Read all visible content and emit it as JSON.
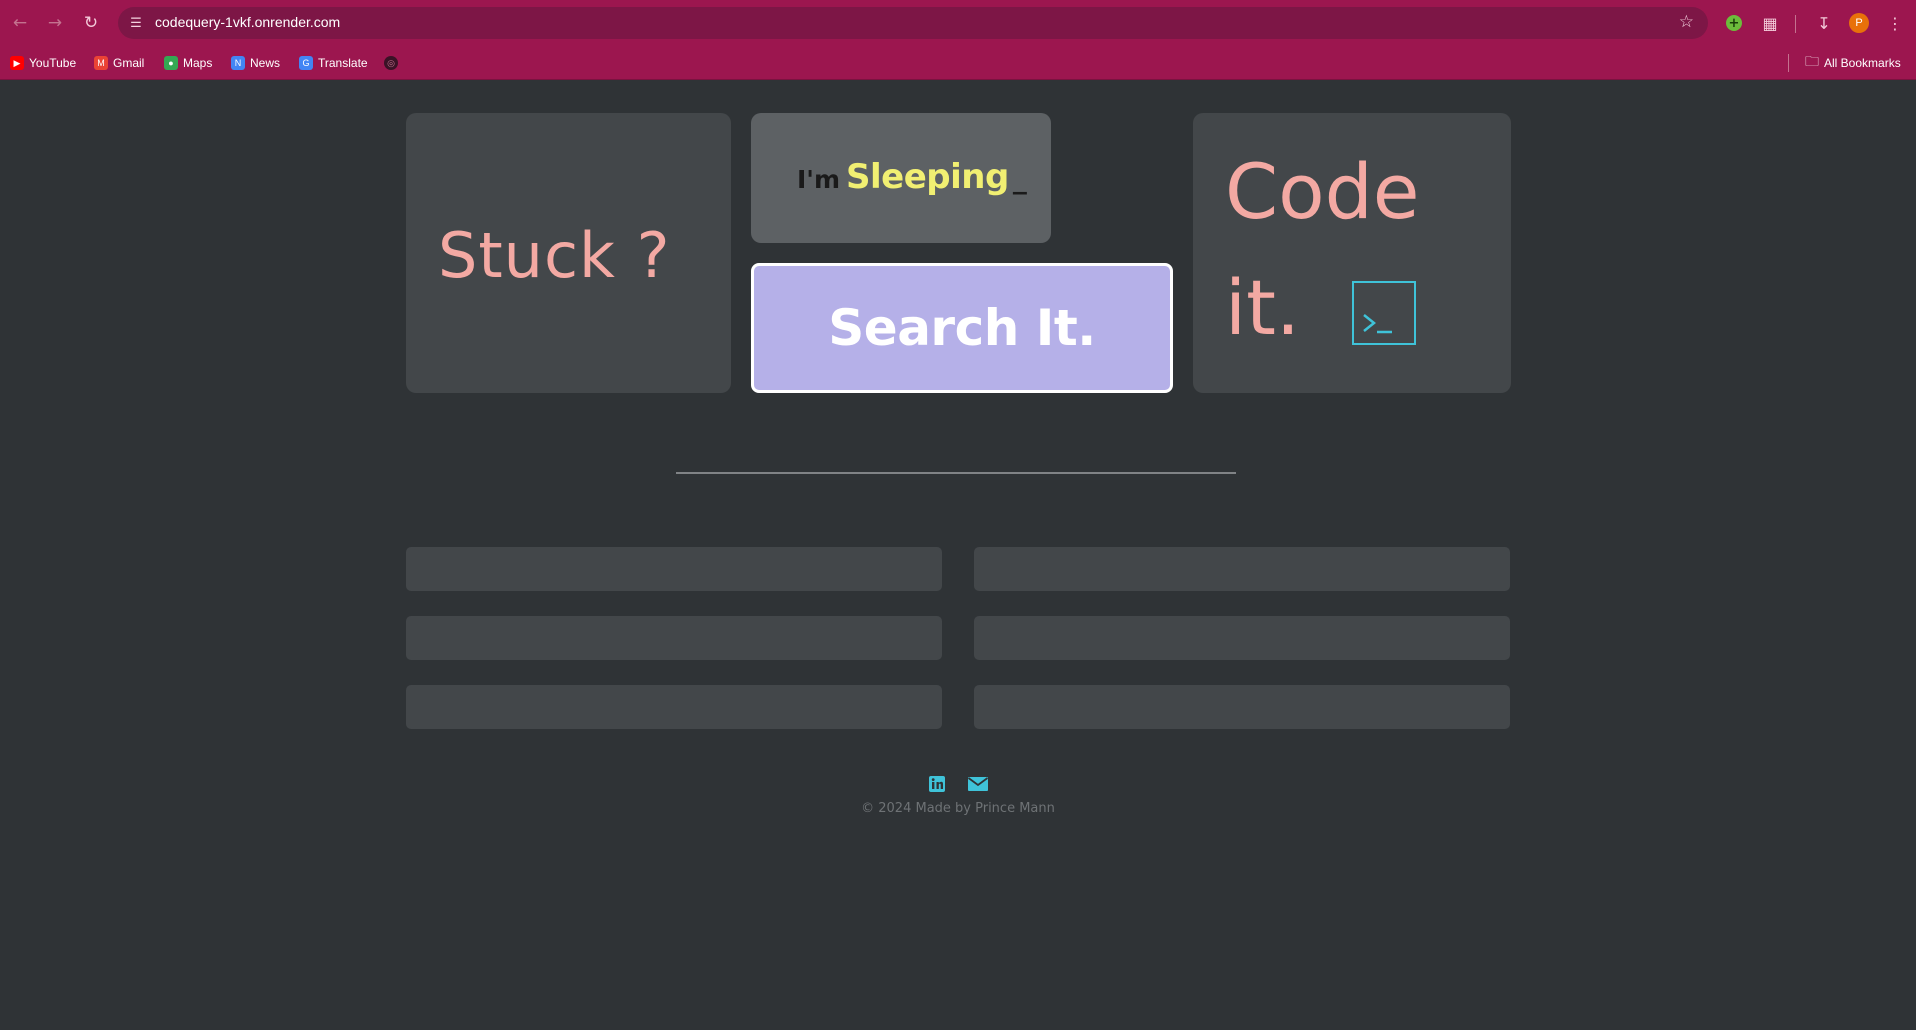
{
  "browser": {
    "url": "codequery-1vkf.onrender.com",
    "bookmarks": [
      {
        "label": "YouTube",
        "color": "#ff0000"
      },
      {
        "label": "Gmail",
        "color": "#ea4335"
      },
      {
        "label": "Maps",
        "color": "#34a853"
      },
      {
        "label": "News",
        "color": "#4285f4"
      },
      {
        "label": "Translate",
        "color": "#4285f4"
      }
    ],
    "all_bookmarks": "All Bookmarks",
    "profile_initial": "P"
  },
  "hero": {
    "stuck": "Stuck ?",
    "im": "I'm",
    "typed_word": "Sleeping",
    "cursor": "_",
    "search_button": "Search It.",
    "code_line1": "Code",
    "code_line2": "it."
  },
  "footer": {
    "text": "© 2024 Made by Prince Mann",
    "links": [
      "linkedin-icon",
      "mail-icon"
    ]
  },
  "colors": {
    "brand_bar": "#9c164f",
    "background": "#2f3336",
    "accent_pink": "#f3a9a3",
    "accent_yellow": "#f1ef72",
    "accent_purple": "#b5b0e8",
    "accent_cyan": "#3fc3d9"
  }
}
